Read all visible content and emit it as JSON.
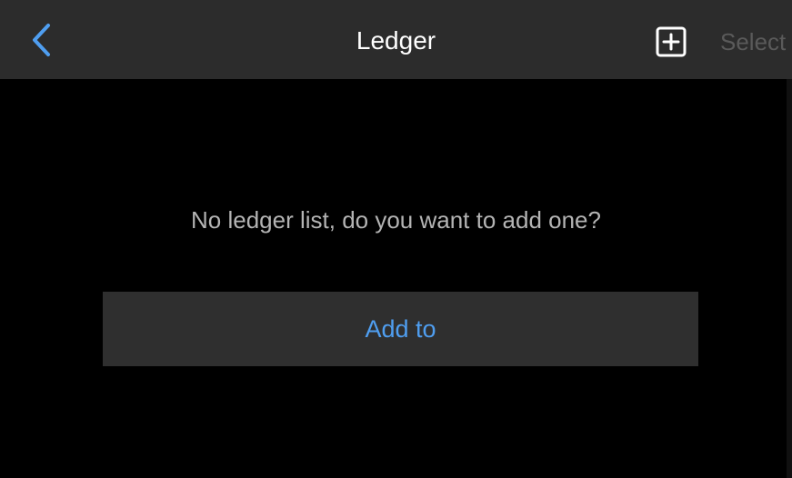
{
  "header": {
    "title": "Ledger",
    "back_icon": "chevron-left-icon",
    "add_icon": "plus-square-icon",
    "select_label": "Select"
  },
  "empty_state": {
    "message": "No ledger list, do you want to add one?",
    "button_label": "Add to"
  },
  "colors": {
    "background": "#000000",
    "topbar": "#2c2c2c",
    "accent": "#4f9ef0",
    "button_background": "#2f2f2f",
    "message_text": "#b4b4b4",
    "disabled_text": "#5a5a5a"
  }
}
